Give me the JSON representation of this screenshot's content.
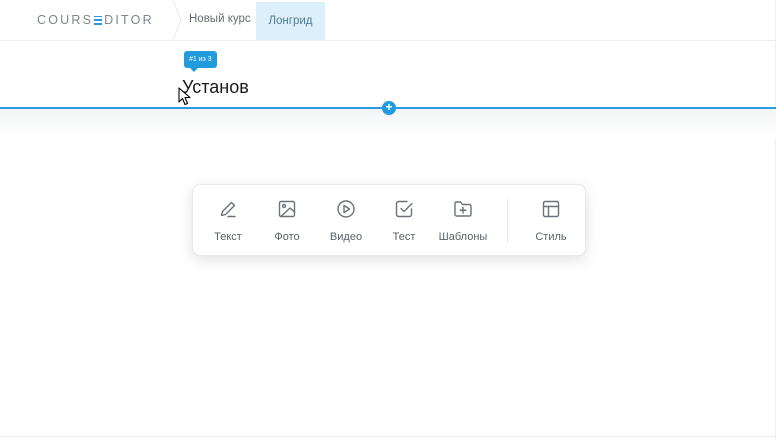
{
  "header": {
    "logo_left": "COURS",
    "logo_right": "DITOR",
    "breadcrumb": [
      "Новый курс",
      "Лонгрид"
    ]
  },
  "editor": {
    "badge": "#1 из 3",
    "title": "Установ",
    "add_symbol": "+"
  },
  "toolbar": {
    "items": [
      {
        "label": "Текст",
        "icon": "pencil-icon"
      },
      {
        "label": "Фото",
        "icon": "image-icon"
      },
      {
        "label": "Видео",
        "icon": "play-icon"
      },
      {
        "label": "Тест",
        "icon": "checkbox-icon"
      },
      {
        "label": "Шаблоны",
        "icon": "folder-plus-icon"
      },
      {
        "label": "Стиль",
        "icon": "layout-icon"
      }
    ]
  },
  "colors": {
    "accent": "#219bdc",
    "active_tab": "#dcf0fb"
  }
}
